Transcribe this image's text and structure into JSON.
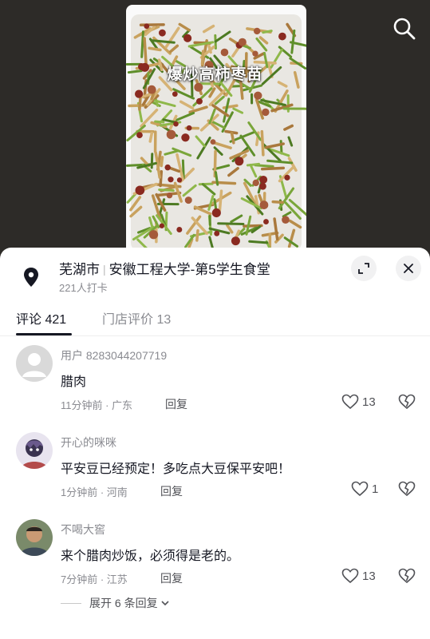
{
  "video": {
    "caption": "爆炒高柿枣苗"
  },
  "location": {
    "title": "芜湖市",
    "separator": "|",
    "place": "安徽工程大学-第5学生食堂",
    "checkins": "221人打卡"
  },
  "tabs": [
    {
      "label": "评论 421"
    },
    {
      "label": "门店评价 13"
    }
  ],
  "comments": [
    {
      "user": "用户 8283044207719",
      "text": "腊肉",
      "time_location": "11分钟前 · 广东",
      "reply": "回复",
      "likes": "13"
    },
    {
      "user": "开心的咪咪",
      "text": "平安豆已经预定！多吃点大豆保平安吧！",
      "time_location": "1分钟前 · 河南",
      "reply": "回复",
      "likes": "1"
    },
    {
      "user": "不喝大窖",
      "text": "来个腊肉炒饭，必须得是老的。",
      "time_location": "7分钟前 · 江苏",
      "reply": "回复",
      "likes": "13"
    }
  ],
  "expand_replies": "展开 6 条回复",
  "icons": {
    "search": "search-icon",
    "pin": "location-pin-icon",
    "expand": "expand-icon",
    "close": "close-icon",
    "like": "heart-icon",
    "dislike": "broken-heart-icon"
  }
}
